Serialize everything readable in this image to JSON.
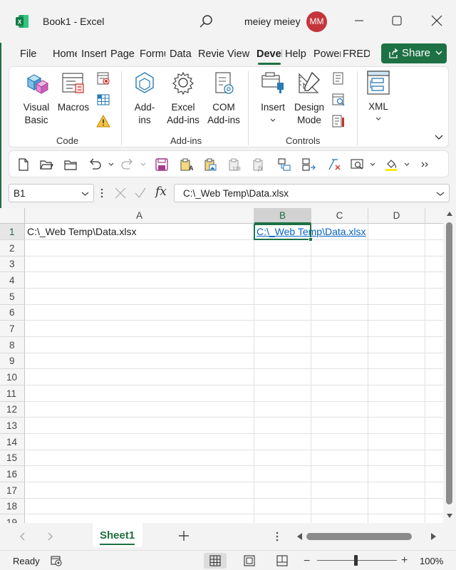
{
  "window": {
    "title": "Book1  -  Excel",
    "user_name": "meiey meiey",
    "avatar_initials": "MM"
  },
  "ribbon_tabs": [
    {
      "label": "File"
    },
    {
      "label": "Home"
    },
    {
      "label": "Insert"
    },
    {
      "label": "Page Layout"
    },
    {
      "label": "Formulas"
    },
    {
      "label": "Data"
    },
    {
      "label": "Review"
    },
    {
      "label": "View"
    },
    {
      "label": "Developer",
      "active": true
    },
    {
      "label": "Help"
    },
    {
      "label": "Power Pivot"
    },
    {
      "label": "FRED"
    }
  ],
  "share": {
    "label": "Share"
  },
  "ribbon": {
    "code": {
      "group_label": "Code",
      "visual_basic": "Visual\nBasic",
      "macros": "Macros"
    },
    "addins": {
      "group_label": "Add-ins",
      "addins": "Add-\nins",
      "excel_addins": "Excel\nAdd-ins",
      "com_addins": "COM\nAdd-ins"
    },
    "controls": {
      "group_label": "Controls",
      "insert": "Insert",
      "design_mode": "Design\nMode"
    },
    "xml": {
      "label": "XML"
    }
  },
  "formula_bar": {
    "name_box": "B1",
    "formula": "C:\\_Web Temp\\Data.xlsx"
  },
  "grid": {
    "columns": [
      "A",
      "B",
      "C",
      "D"
    ],
    "rows": [
      "1",
      "2",
      "3",
      "4",
      "5",
      "6",
      "7",
      "8",
      "9",
      "10",
      "11",
      "12",
      "13",
      "14",
      "15",
      "16",
      "17",
      "18",
      "19"
    ],
    "cells": {
      "A1": "C:\\_Web Temp\\Data.xlsx",
      "B1": "C:\\_Web Temp\\Data.xlsx"
    },
    "selected_cell": "B1"
  },
  "sheets": [
    {
      "label": "Sheet1",
      "active": true
    }
  ],
  "status": {
    "ready": "Ready",
    "zoom": "100%"
  },
  "colors": {
    "accent": "#1e7145",
    "avatar": "#c4353b",
    "link": "#0563c1"
  },
  "icons": [
    "excel-logo-icon",
    "search-icon",
    "minimize-icon",
    "maximize-icon",
    "close-icon",
    "share-icon",
    "visual-basic-icon",
    "macros-icon",
    "record-macro-icon",
    "relative-references-icon",
    "macro-security-icon",
    "addins-icon",
    "excel-addins-icon",
    "com-addins-icon",
    "insert-control-icon",
    "design-mode-icon",
    "properties-icon",
    "view-code-icon",
    "run-dialog-icon",
    "xml-icon"
  ]
}
